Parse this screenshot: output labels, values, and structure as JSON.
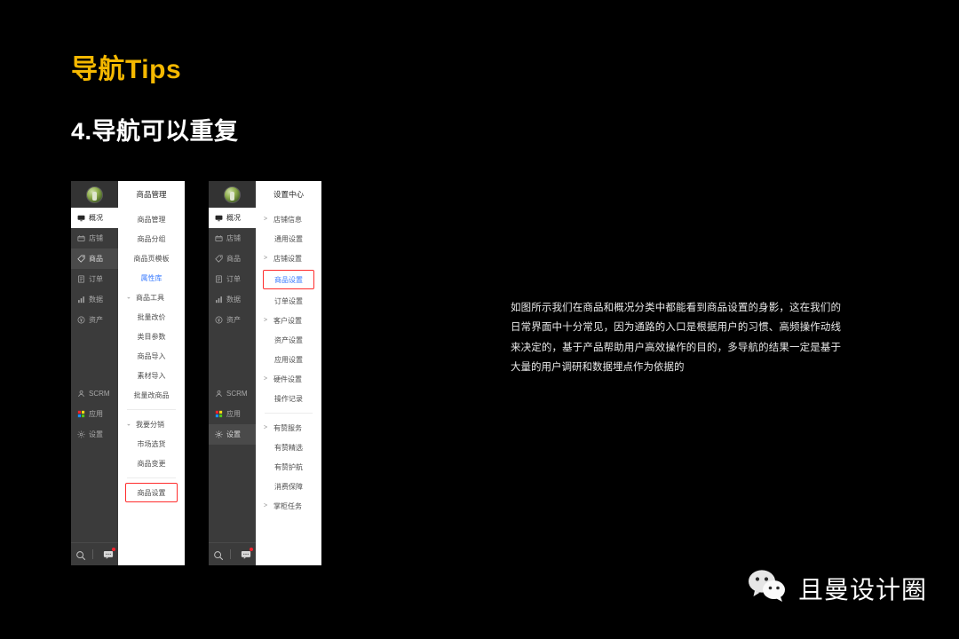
{
  "slide": {
    "title": "导航Tips",
    "subtitle": "4.导航可以重复",
    "title_color": "#F5B800",
    "background": "#000000",
    "body_text": "如图所示我们在商品和概况分类中都能看到商品设置的身影，这在我们的日常界面中十分常见，因为通路的入口是根据用户的习惯、高频操作动线来决定的，基于产品帮助用户高效操作的目的，多导航的结果一定是基于大量的用户调研和数据埋点作为依据的"
  },
  "accents": {
    "annotation_red": "#FF2D2D",
    "active_blue": "#3B7CFF",
    "badge_red": "#F5222D"
  },
  "rail": {
    "items": [
      {
        "label": "概况",
        "icon": "dashboard-icon"
      },
      {
        "label": "店铺",
        "icon": "shop-icon"
      },
      {
        "label": "商品",
        "icon": "tag-icon"
      },
      {
        "label": "订单",
        "icon": "order-icon"
      },
      {
        "label": "数据",
        "icon": "chart-icon"
      },
      {
        "label": "资产",
        "icon": "asset-icon"
      }
    ],
    "lower_items": [
      {
        "label": "SCRM",
        "icon": "person-icon"
      },
      {
        "label": "应用",
        "icon": "apps-icon"
      },
      {
        "label": "设置",
        "icon": "gear-icon"
      }
    ],
    "bottom": {
      "search_icon": "search-icon",
      "chat_icon": "chat-icon",
      "has_badge": true
    }
  },
  "panel_products": {
    "name": "商品管理",
    "rail_active": "概况",
    "rail_highlight": "商品",
    "rows": [
      {
        "label": "商品管理",
        "style": "plain"
      },
      {
        "label": "商品分组",
        "style": "plain"
      },
      {
        "label": "商品页模板",
        "style": "plain"
      },
      {
        "label": "属性库",
        "style": "blue"
      },
      {
        "label": "商品工具",
        "style": "group"
      },
      {
        "label": "批量改价",
        "style": "plain"
      },
      {
        "label": "类目参数",
        "style": "plain"
      },
      {
        "label": "商品导入",
        "style": "plain"
      },
      {
        "label": "素材导入",
        "style": "plain"
      },
      {
        "label": "批量改商品",
        "style": "plain"
      },
      {
        "label": "divider",
        "style": "divider"
      },
      {
        "label": "我要分销",
        "style": "group"
      },
      {
        "label": "市场选货",
        "style": "plain"
      },
      {
        "label": "商品变更",
        "style": "plain"
      },
      {
        "label": "divider",
        "style": "divider"
      },
      {
        "label": "商品设置",
        "style": "redbox"
      }
    ]
  },
  "panel_settings": {
    "name": "设置中心",
    "rail_active": "概况",
    "rail_highlight": "设置",
    "rows": [
      {
        "label": "店铺信息",
        "style": "caret"
      },
      {
        "label": "通用设置",
        "style": "plain"
      },
      {
        "label": "店铺设置",
        "style": "caret"
      },
      {
        "label": "商品设置",
        "style": "redbox-blue"
      },
      {
        "label": "订单设置",
        "style": "plain"
      },
      {
        "label": "客户设置",
        "style": "caret"
      },
      {
        "label": "资产设置",
        "style": "plain"
      },
      {
        "label": "应用设置",
        "style": "plain"
      },
      {
        "label": "硬件设置",
        "style": "caret"
      },
      {
        "label": "操作记录",
        "style": "plain"
      },
      {
        "label": "divider",
        "style": "divider"
      },
      {
        "label": "有赞服务",
        "style": "caret"
      },
      {
        "label": "有赞精选",
        "style": "plain"
      },
      {
        "label": "有赞护航",
        "style": "plain"
      },
      {
        "label": "消费保障",
        "style": "plain"
      },
      {
        "label": "掌柜任务",
        "style": "caret"
      }
    ]
  },
  "brand": {
    "name": "且曼设计圈",
    "icon": "wechat-icon"
  }
}
